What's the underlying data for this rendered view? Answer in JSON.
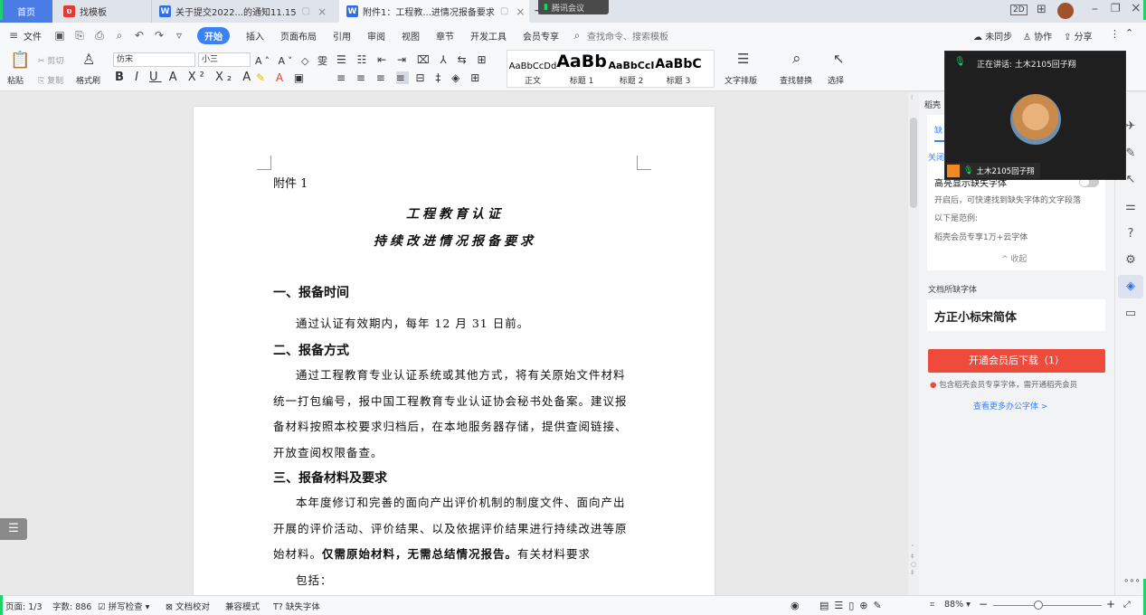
{
  "tabs": [
    {
      "label": "首页"
    },
    {
      "label": "找模板"
    },
    {
      "label": "关于提交2022...的通知11.15"
    },
    {
      "label": "附件1：工程教...进情况报备要求"
    }
  ],
  "tencent_meeting": "腾讯会议",
  "window_controls": {
    "badge": "2D"
  },
  "menu": {
    "file": "文件",
    "start": "开始",
    "items": [
      "插入",
      "页面布局",
      "引用",
      "审阅",
      "视图",
      "章节",
      "开发工具",
      "会员专享"
    ],
    "search": "查找命令、搜索模板",
    "unsync": "未同步",
    "collab": "协作",
    "share": "分享"
  },
  "ribbon": {
    "paste": "粘贴",
    "cut": "剪切",
    "copy": "复制",
    "format_painter": "格式刷",
    "font_name": "仿宋",
    "font_size": "小三",
    "styles": [
      {
        "preview": "AaBbCcDd",
        "name": "正文"
      },
      {
        "preview": "AaBb",
        "name": "标题 1"
      },
      {
        "preview": "AaBbCcI",
        "name": "标题 2"
      },
      {
        "preview": "AaBbC",
        "name": "标题 3"
      }
    ],
    "text_layout": "文字排版",
    "find_replace": "查找替换",
    "select": "选择"
  },
  "document": {
    "attachment": "附件 1",
    "title1": "工程教育认证",
    "title2": "持续改进情况报备要求",
    "h1": "一、报备时间",
    "p1": "通过认证有效期内，每年 12 月 31 日前。",
    "h2": "二、报备方式",
    "p2": "通过工程教育专业认证系统或其他方式，将有关原始文件材料统一打包编号，报中国工程教育专业认证协会秘书处备案。建议报备材料按照本校要求归档后，在本地服务器存储，提供查阅链接、开放查阅权限备查。",
    "h3": "三、报备材料及要求",
    "p3_a": "本年度修订和完善的面向产出评价机制的制度文件、面向产出开展的评价活动、评价结果、以及依据评价结果进行持续改进等原始材料。",
    "p3_bold": "仅需原始材料，无需总结情况报告。",
    "p3_b": "有关材料要求",
    "p3_c": "包括："
  },
  "panel": {
    "title": "稻壳",
    "tab_missing": "缺",
    "close": "关闭",
    "highlight_label": "高亮显示缺失字体",
    "highlight_desc": "开启后，可快速找到缺失字体的文字段落",
    "example_label": "以下是范例:",
    "example_text": "稻壳会员专享1万+云字体",
    "collapse": "收起",
    "missing_fonts_label": "文档所缺字体",
    "missing_font": "方正小标宋简体",
    "download_btn": "开通会员后下载（1）",
    "notice": "包含稻壳会员专享字体，需开通稻壳会员",
    "more_link": "查看更多办公字体 >"
  },
  "meeting": {
    "speaking": "正在讲话: 土木2105回子翔",
    "participant": "土木2105回子翔"
  },
  "status": {
    "page": "页面: 1/3",
    "words": "字数: 886",
    "spell": "拼写检查",
    "proof": "文档校对",
    "compat": "兼容模式",
    "missing_font": "缺失字体",
    "zoom": "88%"
  },
  "colors": {
    "accent": "#3b82f6",
    "download_btn": "#ef4b3c",
    "meeting_bg": "#1f1f1f",
    "edge_green": "#1fd16b"
  }
}
